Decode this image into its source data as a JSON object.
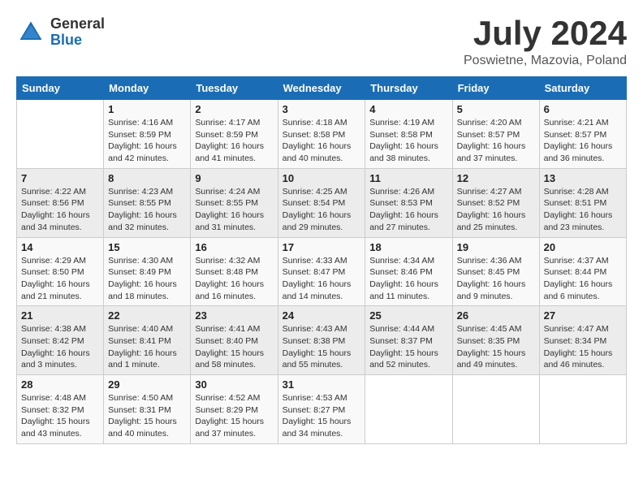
{
  "header": {
    "logo_general": "General",
    "logo_blue": "Blue",
    "month_title": "July 2024",
    "location": "Poswietne, Mazovia, Poland"
  },
  "days_of_week": [
    "Sunday",
    "Monday",
    "Tuesday",
    "Wednesday",
    "Thursday",
    "Friday",
    "Saturday"
  ],
  "weeks": [
    [
      {
        "day": "",
        "detail": ""
      },
      {
        "day": "1",
        "detail": "Sunrise: 4:16 AM\nSunset: 8:59 PM\nDaylight: 16 hours\nand 42 minutes."
      },
      {
        "day": "2",
        "detail": "Sunrise: 4:17 AM\nSunset: 8:59 PM\nDaylight: 16 hours\nand 41 minutes."
      },
      {
        "day": "3",
        "detail": "Sunrise: 4:18 AM\nSunset: 8:58 PM\nDaylight: 16 hours\nand 40 minutes."
      },
      {
        "day": "4",
        "detail": "Sunrise: 4:19 AM\nSunset: 8:58 PM\nDaylight: 16 hours\nand 38 minutes."
      },
      {
        "day": "5",
        "detail": "Sunrise: 4:20 AM\nSunset: 8:57 PM\nDaylight: 16 hours\nand 37 minutes."
      },
      {
        "day": "6",
        "detail": "Sunrise: 4:21 AM\nSunset: 8:57 PM\nDaylight: 16 hours\nand 36 minutes."
      }
    ],
    [
      {
        "day": "7",
        "detail": "Sunrise: 4:22 AM\nSunset: 8:56 PM\nDaylight: 16 hours\nand 34 minutes."
      },
      {
        "day": "8",
        "detail": "Sunrise: 4:23 AM\nSunset: 8:55 PM\nDaylight: 16 hours\nand 32 minutes."
      },
      {
        "day": "9",
        "detail": "Sunrise: 4:24 AM\nSunset: 8:55 PM\nDaylight: 16 hours\nand 31 minutes."
      },
      {
        "day": "10",
        "detail": "Sunrise: 4:25 AM\nSunset: 8:54 PM\nDaylight: 16 hours\nand 29 minutes."
      },
      {
        "day": "11",
        "detail": "Sunrise: 4:26 AM\nSunset: 8:53 PM\nDaylight: 16 hours\nand 27 minutes."
      },
      {
        "day": "12",
        "detail": "Sunrise: 4:27 AM\nSunset: 8:52 PM\nDaylight: 16 hours\nand 25 minutes."
      },
      {
        "day": "13",
        "detail": "Sunrise: 4:28 AM\nSunset: 8:51 PM\nDaylight: 16 hours\nand 23 minutes."
      }
    ],
    [
      {
        "day": "14",
        "detail": "Sunrise: 4:29 AM\nSunset: 8:50 PM\nDaylight: 16 hours\nand 21 minutes."
      },
      {
        "day": "15",
        "detail": "Sunrise: 4:30 AM\nSunset: 8:49 PM\nDaylight: 16 hours\nand 18 minutes."
      },
      {
        "day": "16",
        "detail": "Sunrise: 4:32 AM\nSunset: 8:48 PM\nDaylight: 16 hours\nand 16 minutes."
      },
      {
        "day": "17",
        "detail": "Sunrise: 4:33 AM\nSunset: 8:47 PM\nDaylight: 16 hours\nand 14 minutes."
      },
      {
        "day": "18",
        "detail": "Sunrise: 4:34 AM\nSunset: 8:46 PM\nDaylight: 16 hours\nand 11 minutes."
      },
      {
        "day": "19",
        "detail": "Sunrise: 4:36 AM\nSunset: 8:45 PM\nDaylight: 16 hours\nand 9 minutes."
      },
      {
        "day": "20",
        "detail": "Sunrise: 4:37 AM\nSunset: 8:44 PM\nDaylight: 16 hours\nand 6 minutes."
      }
    ],
    [
      {
        "day": "21",
        "detail": "Sunrise: 4:38 AM\nSunset: 8:42 PM\nDaylight: 16 hours\nand 3 minutes."
      },
      {
        "day": "22",
        "detail": "Sunrise: 4:40 AM\nSunset: 8:41 PM\nDaylight: 16 hours\nand 1 minute."
      },
      {
        "day": "23",
        "detail": "Sunrise: 4:41 AM\nSunset: 8:40 PM\nDaylight: 15 hours\nand 58 minutes."
      },
      {
        "day": "24",
        "detail": "Sunrise: 4:43 AM\nSunset: 8:38 PM\nDaylight: 15 hours\nand 55 minutes."
      },
      {
        "day": "25",
        "detail": "Sunrise: 4:44 AM\nSunset: 8:37 PM\nDaylight: 15 hours\nand 52 minutes."
      },
      {
        "day": "26",
        "detail": "Sunrise: 4:45 AM\nSunset: 8:35 PM\nDaylight: 15 hours\nand 49 minutes."
      },
      {
        "day": "27",
        "detail": "Sunrise: 4:47 AM\nSunset: 8:34 PM\nDaylight: 15 hours\nand 46 minutes."
      }
    ],
    [
      {
        "day": "28",
        "detail": "Sunrise: 4:48 AM\nSunset: 8:32 PM\nDaylight: 15 hours\nand 43 minutes."
      },
      {
        "day": "29",
        "detail": "Sunrise: 4:50 AM\nSunset: 8:31 PM\nDaylight: 15 hours\nand 40 minutes."
      },
      {
        "day": "30",
        "detail": "Sunrise: 4:52 AM\nSunset: 8:29 PM\nDaylight: 15 hours\nand 37 minutes."
      },
      {
        "day": "31",
        "detail": "Sunrise: 4:53 AM\nSunset: 8:27 PM\nDaylight: 15 hours\nand 34 minutes."
      },
      {
        "day": "",
        "detail": ""
      },
      {
        "day": "",
        "detail": ""
      },
      {
        "day": "",
        "detail": ""
      }
    ]
  ]
}
